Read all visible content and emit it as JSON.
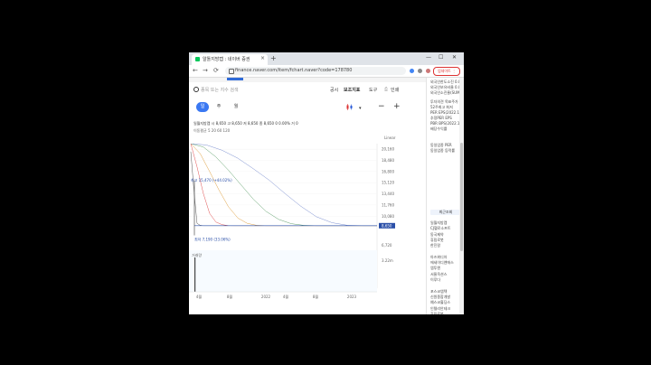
{
  "browser": {
    "tab_title": "알톨지방캡 : 네이버 증권",
    "new_tab": "+",
    "back": "←",
    "forward": "→",
    "reload": "⟳",
    "url": "finance.naver.com/item/fchart.naver?code=178780",
    "update_button": "업데이트 ⋮",
    "window_min": "—",
    "window_max": "☐",
    "window_close": "✕"
  },
  "toolbar": {
    "search_placeholder": "종목 또는 지수 검색",
    "links": [
      "공시",
      "보조지표",
      "도구",
      "인쇄"
    ]
  },
  "periods": [
    "일",
    "주",
    "월"
  ],
  "controls": {
    "zoom_out": "−",
    "zoom_in": "+"
  },
  "stock": {
    "name_line": "일월지방캡  시 8,650  고 8,650  저 8,650  종 8,650  0 0.00%  거 0",
    "ma_line": "이동평균  5  20  60  120"
  },
  "chart_data": {
    "type": "line",
    "scale": "Linear",
    "y_ticks": [
      "20,160",
      "18,480",
      "16,800",
      "15,120",
      "13,440",
      "11,760",
      "10,080"
    ],
    "volume_tick": "6,720",
    "volume_label": "거래량",
    "volume_value": "3.22m",
    "x_ticks": [
      "4월",
      "8월",
      "2022",
      "4월",
      "8월",
      "2023"
    ],
    "last_price_label": "8,650",
    "max_label": "최고 15,470 (+44.02%)",
    "min_label": "최저 7,190 (33.06%)",
    "ylim": [
      6720,
      21000
    ],
    "series": [
      {
        "color": "#555555",
        "values": [
          19800,
          14000,
          9000,
          8700,
          8650,
          8650,
          8650,
          8650,
          8650,
          8650,
          8650,
          8650,
          8650,
          8650,
          8650
        ]
      },
      {
        "color": "#e05050",
        "values": [
          21000,
          17500,
          13500,
          10500,
          9200,
          8800,
          8660,
          8650,
          8650,
          8650,
          8650,
          8650,
          8650,
          8650,
          8650
        ]
      },
      {
        "color": "#e0a040",
        "values": [
          21000,
          19500,
          16800,
          14000,
          11500,
          9800,
          9000,
          8700,
          8650,
          8650,
          8650,
          8650,
          8650,
          8650,
          8650
        ]
      },
      {
        "color": "#5fa06b",
        "values": [
          21000,
          20500,
          19000,
          17000,
          14800,
          12600,
          10800,
          9600,
          8950,
          8700,
          8650,
          8650,
          8650,
          8650,
          8650
        ]
      },
      {
        "color": "#7b8fd0",
        "values": [
          21000,
          20800,
          20000,
          18800,
          17200,
          15500,
          13500,
          11600,
          10000,
          9100,
          8700,
          8650,
          8650,
          8650,
          8650
        ]
      }
    ]
  },
  "side_top": [
    "외국인한도소진 0.00",
    "외국인보유비율 0.00",
    "외국인소진율(SUM) 1.4"
  ],
  "side_mid": [
    "투자의견 목표주가",
    "52주최고 최저",
    "PER EPS(2022.12) 0.9",
    "추정PER EPS",
    "PBR BPS(2022.12)",
    "배당수익률"
  ],
  "side_mid2": [
    "동일업종 PER",
    "동일업종 등락률"
  ],
  "side_header": "최근조회",
  "side_list": [
    "일월지방캡",
    "CJ헬로소프트",
    "동국제약",
    "휴림로봇",
    "한진칼",
    "",
    "아즈위디아",
    "에세이디앤에스",
    "엠투엔",
    "서울옥션스",
    "이루다",
    "",
    "포스코엠텍",
    "신원종합개발",
    "예스코홀딩스",
    "인텔리안테크",
    "휴림로봇"
  ]
}
